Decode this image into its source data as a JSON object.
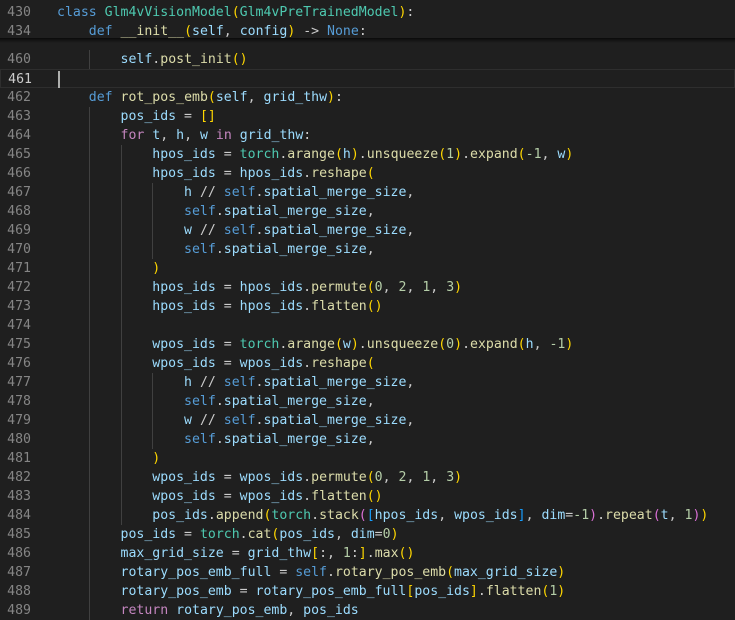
{
  "theme": {
    "background": "#1f1f1f",
    "keyword": "#c586c0",
    "storage": "#569cd6",
    "class": "#4ec9b0",
    "function": "#dcdcaa",
    "variable": "#9cdcfe",
    "number": "#b5cea8",
    "bracket1": "#ffd700",
    "bracket2": "#da70d6",
    "bracket3": "#179fff"
  },
  "sticky": [
    {
      "num": "430",
      "tokens": [
        [
          "class",
          "kb"
        ],
        [
          " ",
          "t"
        ],
        [
          "Glm4vVisionModel",
          "c"
        ],
        [
          "(",
          "p1"
        ],
        [
          "Glm4vPreTrainedModel",
          "c"
        ],
        [
          ")",
          "p1"
        ],
        [
          ":",
          "t"
        ]
      ]
    },
    {
      "num": "434",
      "tokens": [
        [
          "    ",
          "t"
        ],
        [
          "def",
          "kb"
        ],
        [
          " ",
          "t"
        ],
        [
          "__init__",
          "f"
        ],
        [
          "(",
          "p1"
        ],
        [
          "self",
          "v"
        ],
        [
          ", ",
          "t"
        ],
        [
          "config",
          "v"
        ],
        [
          ")",
          "p1"
        ],
        [
          " -> ",
          "t"
        ],
        [
          "None",
          "kb"
        ],
        [
          ":",
          "t"
        ]
      ]
    }
  ],
  "lines": [
    {
      "num": "460",
      "tokens": [
        [
          "        ",
          "t"
        ],
        [
          "self",
          "v"
        ],
        [
          ".",
          "t"
        ],
        [
          "post_init",
          "f"
        ],
        [
          "(",
          "p1"
        ],
        [
          ")",
          "p1"
        ]
      ]
    },
    {
      "num": "461",
      "current": true,
      "tokens": []
    },
    {
      "num": "462",
      "tokens": [
        [
          "    ",
          "t"
        ],
        [
          "def",
          "kb"
        ],
        [
          " ",
          "t"
        ],
        [
          "rot_pos_emb",
          "f"
        ],
        [
          "(",
          "p1"
        ],
        [
          "self",
          "v"
        ],
        [
          ", ",
          "t"
        ],
        [
          "grid_thw",
          "v"
        ],
        [
          ")",
          "p1"
        ],
        [
          ":",
          "t"
        ]
      ]
    },
    {
      "num": "463",
      "tokens": [
        [
          "        ",
          "t"
        ],
        [
          "pos_ids",
          "v"
        ],
        [
          " = ",
          "t"
        ],
        [
          "[",
          "p1"
        ],
        [
          "]",
          "p1"
        ]
      ]
    },
    {
      "num": "464",
      "tokens": [
        [
          "        ",
          "t"
        ],
        [
          "for",
          "k"
        ],
        [
          " ",
          "t"
        ],
        [
          "t",
          "v"
        ],
        [
          ", ",
          "t"
        ],
        [
          "h",
          "v"
        ],
        [
          ", ",
          "t"
        ],
        [
          "w",
          "v"
        ],
        [
          " ",
          "t"
        ],
        [
          "in",
          "k"
        ],
        [
          " ",
          "t"
        ],
        [
          "grid_thw",
          "v"
        ],
        [
          ":",
          "t"
        ]
      ]
    },
    {
      "num": "465",
      "tokens": [
        [
          "            ",
          "t"
        ],
        [
          "hpos_ids",
          "v"
        ],
        [
          " = ",
          "t"
        ],
        [
          "torch",
          "c"
        ],
        [
          ".",
          "t"
        ],
        [
          "arange",
          "f"
        ],
        [
          "(",
          "p1"
        ],
        [
          "h",
          "v"
        ],
        [
          ")",
          "p1"
        ],
        [
          ".",
          "t"
        ],
        [
          "unsqueeze",
          "f"
        ],
        [
          "(",
          "p1"
        ],
        [
          "1",
          "n"
        ],
        [
          ")",
          "p1"
        ],
        [
          ".",
          "t"
        ],
        [
          "expand",
          "f"
        ],
        [
          "(",
          "p1"
        ],
        [
          "-1",
          "n"
        ],
        [
          ", ",
          "t"
        ],
        [
          "w",
          "v"
        ],
        [
          ")",
          "p1"
        ]
      ]
    },
    {
      "num": "466",
      "tokens": [
        [
          "            ",
          "t"
        ],
        [
          "hpos_ids",
          "v"
        ],
        [
          " = ",
          "t"
        ],
        [
          "hpos_ids",
          "v"
        ],
        [
          ".",
          "t"
        ],
        [
          "reshape",
          "f"
        ],
        [
          "(",
          "p1"
        ]
      ]
    },
    {
      "num": "467",
      "tokens": [
        [
          "                ",
          "t"
        ],
        [
          "h",
          "v"
        ],
        [
          " // ",
          "t"
        ],
        [
          "self",
          "kb"
        ],
        [
          ".",
          "t"
        ],
        [
          "spatial_merge_size",
          "v"
        ],
        [
          ",",
          "t"
        ]
      ]
    },
    {
      "num": "468",
      "tokens": [
        [
          "                ",
          "t"
        ],
        [
          "self",
          "kb"
        ],
        [
          ".",
          "t"
        ],
        [
          "spatial_merge_size",
          "v"
        ],
        [
          ",",
          "t"
        ]
      ]
    },
    {
      "num": "469",
      "tokens": [
        [
          "                ",
          "t"
        ],
        [
          "w",
          "v"
        ],
        [
          " // ",
          "t"
        ],
        [
          "self",
          "kb"
        ],
        [
          ".",
          "t"
        ],
        [
          "spatial_merge_size",
          "v"
        ],
        [
          ",",
          "t"
        ]
      ]
    },
    {
      "num": "470",
      "tokens": [
        [
          "                ",
          "t"
        ],
        [
          "self",
          "kb"
        ],
        [
          ".",
          "t"
        ],
        [
          "spatial_merge_size",
          "v"
        ],
        [
          ",",
          "t"
        ]
      ]
    },
    {
      "num": "471",
      "tokens": [
        [
          "            ",
          "t"
        ],
        [
          ")",
          "p1"
        ]
      ]
    },
    {
      "num": "472",
      "tokens": [
        [
          "            ",
          "t"
        ],
        [
          "hpos_ids",
          "v"
        ],
        [
          " = ",
          "t"
        ],
        [
          "hpos_ids",
          "v"
        ],
        [
          ".",
          "t"
        ],
        [
          "permute",
          "f"
        ],
        [
          "(",
          "p1"
        ],
        [
          "0",
          "n"
        ],
        [
          ", ",
          "t"
        ],
        [
          "2",
          "n"
        ],
        [
          ", ",
          "t"
        ],
        [
          "1",
          "n"
        ],
        [
          ", ",
          "t"
        ],
        [
          "3",
          "n"
        ],
        [
          ")",
          "p1"
        ]
      ]
    },
    {
      "num": "473",
      "tokens": [
        [
          "            ",
          "t"
        ],
        [
          "hpos_ids",
          "v"
        ],
        [
          " = ",
          "t"
        ],
        [
          "hpos_ids",
          "v"
        ],
        [
          ".",
          "t"
        ],
        [
          "flatten",
          "f"
        ],
        [
          "(",
          "p1"
        ],
        [
          ")",
          "p1"
        ]
      ]
    },
    {
      "num": "474",
      "tokens": []
    },
    {
      "num": "475",
      "tokens": [
        [
          "            ",
          "t"
        ],
        [
          "wpos_ids",
          "v"
        ],
        [
          " = ",
          "t"
        ],
        [
          "torch",
          "c"
        ],
        [
          ".",
          "t"
        ],
        [
          "arange",
          "f"
        ],
        [
          "(",
          "p1"
        ],
        [
          "w",
          "v"
        ],
        [
          ")",
          "p1"
        ],
        [
          ".",
          "t"
        ],
        [
          "unsqueeze",
          "f"
        ],
        [
          "(",
          "p1"
        ],
        [
          "0",
          "n"
        ],
        [
          ")",
          "p1"
        ],
        [
          ".",
          "t"
        ],
        [
          "expand",
          "f"
        ],
        [
          "(",
          "p1"
        ],
        [
          "h",
          "v"
        ],
        [
          ", ",
          "t"
        ],
        [
          "-1",
          "n"
        ],
        [
          ")",
          "p1"
        ]
      ]
    },
    {
      "num": "476",
      "tokens": [
        [
          "            ",
          "t"
        ],
        [
          "wpos_ids",
          "v"
        ],
        [
          " = ",
          "t"
        ],
        [
          "wpos_ids",
          "v"
        ],
        [
          ".",
          "t"
        ],
        [
          "reshape",
          "f"
        ],
        [
          "(",
          "p1"
        ]
      ]
    },
    {
      "num": "477",
      "tokens": [
        [
          "                ",
          "t"
        ],
        [
          "h",
          "v"
        ],
        [
          " // ",
          "t"
        ],
        [
          "self",
          "kb"
        ],
        [
          ".",
          "t"
        ],
        [
          "spatial_merge_size",
          "v"
        ],
        [
          ",",
          "t"
        ]
      ]
    },
    {
      "num": "478",
      "tokens": [
        [
          "                ",
          "t"
        ],
        [
          "self",
          "kb"
        ],
        [
          ".",
          "t"
        ],
        [
          "spatial_merge_size",
          "v"
        ],
        [
          ",",
          "t"
        ]
      ]
    },
    {
      "num": "479",
      "tokens": [
        [
          "                ",
          "t"
        ],
        [
          "w",
          "v"
        ],
        [
          " // ",
          "t"
        ],
        [
          "self",
          "kb"
        ],
        [
          ".",
          "t"
        ],
        [
          "spatial_merge_size",
          "v"
        ],
        [
          ",",
          "t"
        ]
      ]
    },
    {
      "num": "480",
      "tokens": [
        [
          "                ",
          "t"
        ],
        [
          "self",
          "kb"
        ],
        [
          ".",
          "t"
        ],
        [
          "spatial_merge_size",
          "v"
        ],
        [
          ",",
          "t"
        ]
      ]
    },
    {
      "num": "481",
      "tokens": [
        [
          "            ",
          "t"
        ],
        [
          ")",
          "p1"
        ]
      ]
    },
    {
      "num": "482",
      "tokens": [
        [
          "            ",
          "t"
        ],
        [
          "wpos_ids",
          "v"
        ],
        [
          " = ",
          "t"
        ],
        [
          "wpos_ids",
          "v"
        ],
        [
          ".",
          "t"
        ],
        [
          "permute",
          "f"
        ],
        [
          "(",
          "p1"
        ],
        [
          "0",
          "n"
        ],
        [
          ", ",
          "t"
        ],
        [
          "2",
          "n"
        ],
        [
          ", ",
          "t"
        ],
        [
          "1",
          "n"
        ],
        [
          ", ",
          "t"
        ],
        [
          "3",
          "n"
        ],
        [
          ")",
          "p1"
        ]
      ]
    },
    {
      "num": "483",
      "tokens": [
        [
          "            ",
          "t"
        ],
        [
          "wpos_ids",
          "v"
        ],
        [
          " = ",
          "t"
        ],
        [
          "wpos_ids",
          "v"
        ],
        [
          ".",
          "t"
        ],
        [
          "flatten",
          "f"
        ],
        [
          "(",
          "p1"
        ],
        [
          ")",
          "p1"
        ]
      ]
    },
    {
      "num": "484",
      "tokens": [
        [
          "            ",
          "t"
        ],
        [
          "pos_ids",
          "v"
        ],
        [
          ".",
          "t"
        ],
        [
          "append",
          "f"
        ],
        [
          "(",
          "p1"
        ],
        [
          "torch",
          "c"
        ],
        [
          ".",
          "t"
        ],
        [
          "stack",
          "f"
        ],
        [
          "(",
          "p2"
        ],
        [
          "[",
          "p3"
        ],
        [
          "hpos_ids",
          "v"
        ],
        [
          ", ",
          "t"
        ],
        [
          "wpos_ids",
          "v"
        ],
        [
          "]",
          "p3"
        ],
        [
          ", ",
          "t"
        ],
        [
          "dim",
          "v"
        ],
        [
          "=",
          "t"
        ],
        [
          "-1",
          "n"
        ],
        [
          ")",
          "p2"
        ],
        [
          ".",
          "t"
        ],
        [
          "repeat",
          "f"
        ],
        [
          "(",
          "p2"
        ],
        [
          "t",
          "v"
        ],
        [
          ", ",
          "t"
        ],
        [
          "1",
          "n"
        ],
        [
          ")",
          "p2"
        ],
        [
          ")",
          "p1"
        ]
      ]
    },
    {
      "num": "485",
      "tokens": [
        [
          "        ",
          "t"
        ],
        [
          "pos_ids",
          "v"
        ],
        [
          " = ",
          "t"
        ],
        [
          "torch",
          "c"
        ],
        [
          ".",
          "t"
        ],
        [
          "cat",
          "f"
        ],
        [
          "(",
          "p1"
        ],
        [
          "pos_ids",
          "v"
        ],
        [
          ", ",
          "t"
        ],
        [
          "dim",
          "v"
        ],
        [
          "=",
          "t"
        ],
        [
          "0",
          "n"
        ],
        [
          ")",
          "p1"
        ]
      ]
    },
    {
      "num": "486",
      "tokens": [
        [
          "        ",
          "t"
        ],
        [
          "max_grid_size",
          "v"
        ],
        [
          " = ",
          "t"
        ],
        [
          "grid_thw",
          "v"
        ],
        [
          "[",
          "p1"
        ],
        [
          ":, ",
          "t"
        ],
        [
          "1",
          "n"
        ],
        [
          ":",
          "t"
        ],
        [
          "]",
          "p1"
        ],
        [
          ".",
          "t"
        ],
        [
          "max",
          "f"
        ],
        [
          "(",
          "p1"
        ],
        [
          ")",
          "p1"
        ]
      ]
    },
    {
      "num": "487",
      "tokens": [
        [
          "        ",
          "t"
        ],
        [
          "rotary_pos_emb_full",
          "v"
        ],
        [
          " = ",
          "t"
        ],
        [
          "self",
          "kb"
        ],
        [
          ".",
          "t"
        ],
        [
          "rotary_pos_emb",
          "f"
        ],
        [
          "(",
          "p1"
        ],
        [
          "max_grid_size",
          "v"
        ],
        [
          ")",
          "p1"
        ]
      ]
    },
    {
      "num": "488",
      "tokens": [
        [
          "        ",
          "t"
        ],
        [
          "rotary_pos_emb",
          "v"
        ],
        [
          " = ",
          "t"
        ],
        [
          "rotary_pos_emb_full",
          "v"
        ],
        [
          "[",
          "p1"
        ],
        [
          "pos_ids",
          "v"
        ],
        [
          "]",
          "p1"
        ],
        [
          ".",
          "t"
        ],
        [
          "flatten",
          "f"
        ],
        [
          "(",
          "p1"
        ],
        [
          "1",
          "n"
        ],
        [
          ")",
          "p1"
        ]
      ]
    },
    {
      "num": "489",
      "tokens": [
        [
          "        ",
          "t"
        ],
        [
          "return",
          "k"
        ],
        [
          " ",
          "t"
        ],
        [
          "rotary_pos_emb",
          "v"
        ],
        [
          ", ",
          "t"
        ],
        [
          "pos_ids",
          "v"
        ]
      ]
    }
  ]
}
